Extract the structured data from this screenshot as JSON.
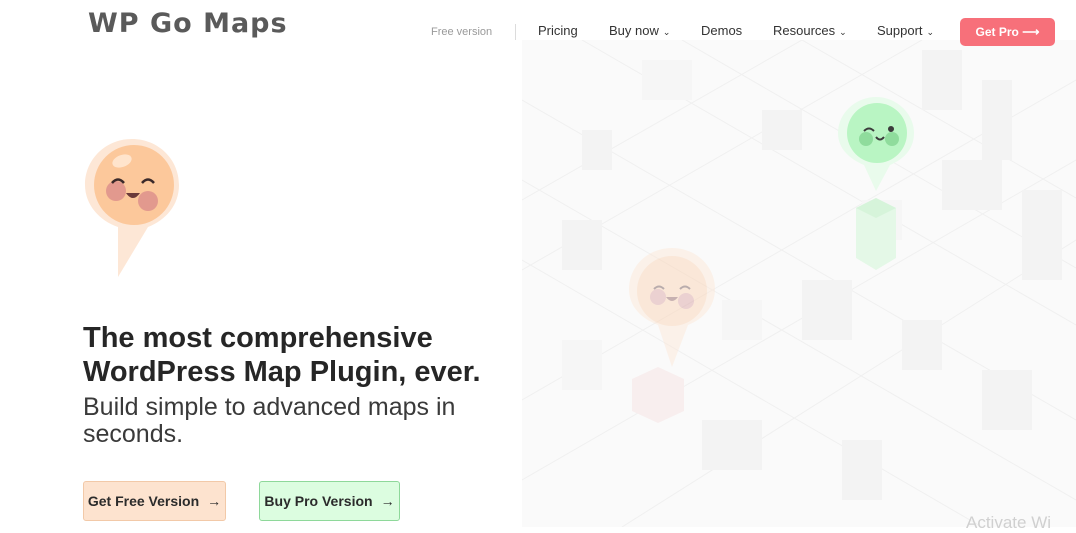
{
  "brand": {
    "logo_text": "WP Go Maps"
  },
  "nav": {
    "free_version": "Free version",
    "items": [
      {
        "label": "Pricing",
        "has_dropdown": false
      },
      {
        "label": "Buy now",
        "has_dropdown": true
      },
      {
        "label": "Demos",
        "has_dropdown": false
      },
      {
        "label": "Resources",
        "has_dropdown": true
      },
      {
        "label": "Support",
        "has_dropdown": true
      }
    ],
    "cta": "Get Pro ⟶"
  },
  "hero": {
    "title": "The most comprehensive WordPress Map Plugin, ever.",
    "subtitle": "Build simple to advanced maps in seconds.",
    "buttons": [
      {
        "label": "Get Free Version",
        "arrow": "→"
      },
      {
        "label": "Buy Pro Version",
        "arrow": "→"
      }
    ]
  },
  "watermark": "Activate Wi",
  "colors": {
    "accent": "#f7707a",
    "free_button_bg": "#fde3cf",
    "pro_button_bg": "#dcfde0",
    "pin_orange": "#fcc89b",
    "pin_green": "#b9f5c3"
  },
  "icons": [
    "orange-pin-mascot-icon",
    "green-pin-mascot-icon",
    "faded-pin-mascot-icon",
    "chevron-down-icon",
    "arrow-right-icon"
  ]
}
